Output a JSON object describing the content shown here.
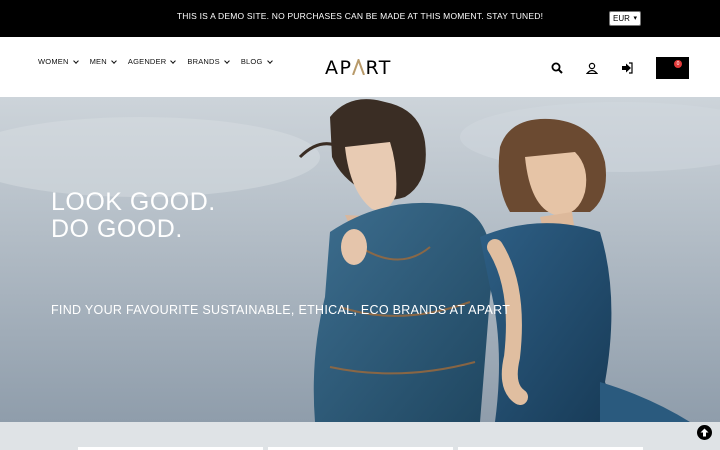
{
  "announcement": {
    "message": "THIS IS A DEMO SITE. NO PURCHASES CAN BE MADE AT THIS MOMENT. STAY TUNED!",
    "currency": "EUR"
  },
  "header": {
    "nav": [
      "WOMEN",
      "MEN",
      "AGENDER",
      "BRANDS",
      "BLOG"
    ],
    "logo_left": "AP",
    "logo_accent": "/\\",
    "logo_right": "RT",
    "cart_count": "0"
  },
  "hero": {
    "headline_line1": "LOOK GOOD.",
    "headline_line2": "DO GOOD.",
    "subline": "FIND YOUR FAVOURITE SUSTAINABLE, ETHICAL, ECO BRANDS AT APART"
  },
  "colors": {
    "topbar": "#000000",
    "logo_accent": "#b89a6a",
    "cart_badge": "#e23a3a"
  },
  "icons": [
    "search-icon",
    "user-icon",
    "login-icon",
    "cart-icon",
    "scroll-top-icon"
  ]
}
